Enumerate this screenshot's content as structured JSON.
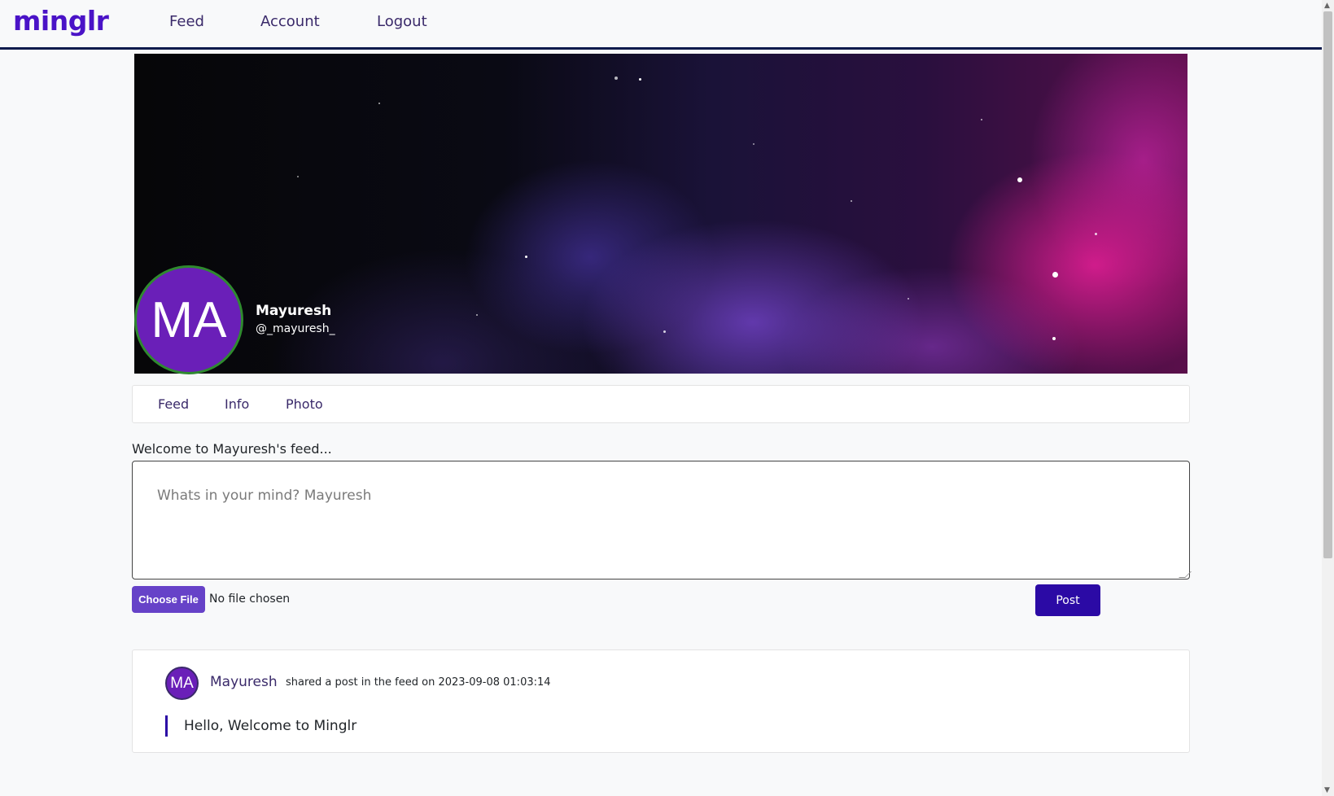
{
  "brand": "minglr",
  "nav": {
    "feed": "Feed",
    "account": "Account",
    "logout": "Logout"
  },
  "profile": {
    "initials": "MA",
    "name": "Mayuresh",
    "handle": "@_mayuresh_"
  },
  "tabs": [
    "Feed",
    "Info",
    "Photo"
  ],
  "feed_input": {
    "welcome": "Welcome to Mayuresh's feed...",
    "placeholder": "Whats in your mind? Mayuresh",
    "choose_file_label": "Choose File",
    "file_status": "No file chosen",
    "post_label": "Post"
  },
  "posts": [
    {
      "initials": "MA",
      "author": "Mayuresh",
      "meta": "shared a post in the feed on 2023-09-08 01:03:14",
      "body": "Hello, Welcome to Minglr"
    }
  ],
  "colors": {
    "brand": "#4a13c7",
    "accent": "#2b0aa5",
    "avatar": "#6a1fb8",
    "nav_border": "#0d1b4c"
  },
  "icons": {
    "scroll_up": "chevron-up-icon",
    "scroll_down": "chevron-down-icon"
  }
}
